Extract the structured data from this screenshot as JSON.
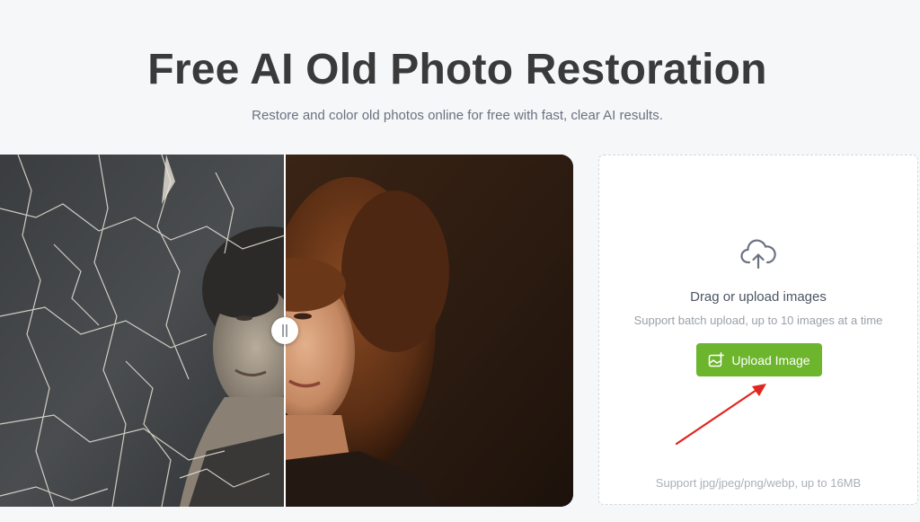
{
  "header": {
    "title": "Free AI Old Photo Restoration",
    "subtitle": "Restore and color old photos online for free with fast, clear AI results."
  },
  "comparison": {
    "divider_handle_icon": "drag-handle-icon"
  },
  "upload": {
    "cloud_icon": "cloud-upload-icon",
    "drag_title": "Drag or upload images",
    "batch_text": "Support batch upload, up to 10 images at a time",
    "button_label": "Upload Image",
    "button_icon": "image-add-icon",
    "formats_text": "Support jpg/jpeg/png/webp, up to 16MB"
  },
  "colors": {
    "page_background": "#f6f7f9",
    "title": "#3a3a3a",
    "button": "#6cb52d",
    "annotation_arrow": "#e0261e"
  }
}
